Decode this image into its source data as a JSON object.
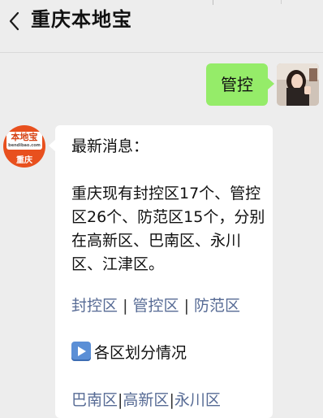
{
  "header": {
    "title": "重庆本地宝"
  },
  "chat": {
    "sent": {
      "text": "管控"
    },
    "reply": {
      "heading": "最新消息：",
      "body": "重庆现有封控区17个、管控区26个、防范区15个，分别在高新区、巴南区、永川区、江津区。",
      "zone_links": [
        "封控区",
        "管控区",
        "防范区"
      ],
      "zone_separator": "|",
      "district_item": "各区划分情况",
      "district_links": [
        "巴南区",
        "高新区",
        "永川区"
      ],
      "district_separator": "|"
    }
  },
  "avatar_bot": {
    "logo_text": "本地宝",
    "logo_sub": "bendibao.com",
    "city": "重庆",
    "color": "#e8501e"
  },
  "colors": {
    "sent_bubble": "#95ec69",
    "link": "#576b95",
    "background": "#ededed"
  }
}
